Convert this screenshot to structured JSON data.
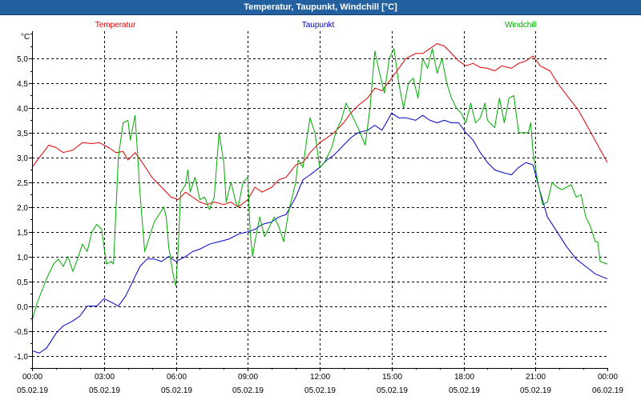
{
  "window": {
    "title": "Temperatur, Taupunkt, Windchill [°C]"
  },
  "chart_data": {
    "type": "line",
    "title": "Temperatur, Taupunkt, Windchill [°C]",
    "ylabel": "°C",
    "ylim": [
      -1.25,
      5.55
    ],
    "xlim": [
      0,
      24
    ],
    "grid": true,
    "legend_position": "top",
    "y_ticks": [
      -1.0,
      -0.5,
      0.0,
      0.5,
      1.0,
      1.5,
      2.0,
      2.5,
      3.0,
      3.5,
      4.0,
      4.5,
      5.0
    ],
    "y_tick_labels": [
      "-1,0",
      "-0,5",
      "0,0",
      "0,5",
      "1,0",
      "1,5",
      "2,0",
      "2,5",
      "3,0",
      "3,5",
      "4,0",
      "4,5",
      "5,0"
    ],
    "x_ticks": [
      {
        "hour": 0,
        "time": "00:00",
        "date": "05.02.19"
      },
      {
        "hour": 3,
        "time": "03:00",
        "date": "05.02.19"
      },
      {
        "hour": 6,
        "time": "06:00",
        "date": "05.02.19"
      },
      {
        "hour": 9,
        "time": "09:00",
        "date": "05.02.19"
      },
      {
        "hour": 12,
        "time": "12:00",
        "date": "05.02.19"
      },
      {
        "hour": 15,
        "time": "15:00",
        "date": "05.02.19"
      },
      {
        "hour": 18,
        "time": "18:00",
        "date": "05.02.19"
      },
      {
        "hour": 21,
        "time": "21:00",
        "date": "05.02.19"
      },
      {
        "hour": 24,
        "time": "00:00",
        "date": "06.02.19"
      }
    ],
    "series": [
      {
        "name": "Temperatur",
        "color": "#e00000",
        "points": [
          [
            0,
            2.8
          ],
          [
            0.3,
            3.0
          ],
          [
            0.7,
            3.25
          ],
          [
            1.0,
            3.2
          ],
          [
            1.3,
            3.1
          ],
          [
            1.7,
            3.15
          ],
          [
            2.1,
            3.3
          ],
          [
            2.5,
            3.28
          ],
          [
            2.8,
            3.3
          ],
          [
            3.2,
            3.2
          ],
          [
            3.5,
            3.1
          ],
          [
            3.8,
            3.12
          ],
          [
            4.0,
            2.95
          ],
          [
            4.3,
            3.1
          ],
          [
            4.6,
            2.9
          ],
          [
            5.0,
            2.6
          ],
          [
            5.4,
            2.4
          ],
          [
            5.8,
            2.2
          ],
          [
            6.1,
            2.15
          ],
          [
            6.4,
            2.3
          ],
          [
            6.7,
            2.2
          ],
          [
            7.0,
            2.1
          ],
          [
            7.3,
            2.05
          ],
          [
            7.6,
            2.1
          ],
          [
            8.0,
            2.05
          ],
          [
            8.3,
            2.1
          ],
          [
            8.6,
            2.0
          ],
          [
            9.0,
            2.15
          ],
          [
            9.3,
            2.4
          ],
          [
            9.6,
            2.3
          ],
          [
            10.0,
            2.4
          ],
          [
            10.3,
            2.55
          ],
          [
            10.6,
            2.6
          ],
          [
            11.0,
            2.85
          ],
          [
            11.3,
            2.9
          ],
          [
            11.6,
            3.1
          ],
          [
            12.0,
            3.3
          ],
          [
            12.3,
            3.4
          ],
          [
            12.6,
            3.5
          ],
          [
            13.0,
            3.7
          ],
          [
            13.3,
            3.9
          ],
          [
            13.6,
            4.05
          ],
          [
            14.0,
            4.2
          ],
          [
            14.3,
            4.4
          ],
          [
            14.6,
            4.35
          ],
          [
            15.0,
            4.6
          ],
          [
            15.3,
            4.8
          ],
          [
            15.6,
            5.0
          ],
          [
            16.0,
            5.1
          ],
          [
            16.3,
            5.1
          ],
          [
            16.6,
            5.2
          ],
          [
            16.9,
            5.3
          ],
          [
            17.2,
            5.25
          ],
          [
            17.5,
            5.1
          ],
          [
            17.8,
            4.95
          ],
          [
            18.1,
            4.85
          ],
          [
            18.4,
            4.9
          ],
          [
            18.7,
            4.82
          ],
          [
            19.0,
            4.8
          ],
          [
            19.3,
            4.75
          ],
          [
            19.6,
            4.85
          ],
          [
            20.0,
            4.8
          ],
          [
            20.3,
            4.9
          ],
          [
            20.6,
            4.95
          ],
          [
            20.9,
            5.05
          ],
          [
            21.2,
            4.85
          ],
          [
            21.6,
            4.75
          ],
          [
            22.0,
            4.45
          ],
          [
            22.4,
            4.2
          ],
          [
            22.8,
            3.95
          ],
          [
            23.2,
            3.6
          ],
          [
            23.6,
            3.25
          ],
          [
            24,
            2.9
          ]
        ]
      },
      {
        "name": "Taupunkt",
        "color": "#0000cc",
        "points": [
          [
            0,
            -0.9
          ],
          [
            0.3,
            -0.95
          ],
          [
            0.6,
            -0.85
          ],
          [
            1.0,
            -0.55
          ],
          [
            1.3,
            -0.4
          ],
          [
            1.7,
            -0.3
          ],
          [
            2.0,
            -0.2
          ],
          [
            2.3,
            0.0
          ],
          [
            2.7,
            0.0
          ],
          [
            3.0,
            0.15
          ],
          [
            3.3,
            0.08
          ],
          [
            3.6,
            0.0
          ],
          [
            3.9,
            0.2
          ],
          [
            4.2,
            0.5
          ],
          [
            4.5,
            0.8
          ],
          [
            4.8,
            0.95
          ],
          [
            5.1,
            0.95
          ],
          [
            5.4,
            0.9
          ],
          [
            5.7,
            1.0
          ],
          [
            6.0,
            0.9
          ],
          [
            6.4,
            1.0
          ],
          [
            6.7,
            1.1
          ],
          [
            7.0,
            1.15
          ],
          [
            7.4,
            1.25
          ],
          [
            7.8,
            1.3
          ],
          [
            8.2,
            1.35
          ],
          [
            8.6,
            1.45
          ],
          [
            9.0,
            1.5
          ],
          [
            9.3,
            1.55
          ],
          [
            9.6,
            1.65
          ],
          [
            10.0,
            1.7
          ],
          [
            10.3,
            1.8
          ],
          [
            10.6,
            1.85
          ],
          [
            11.0,
            2.2
          ],
          [
            11.3,
            2.55
          ],
          [
            11.6,
            2.65
          ],
          [
            12.0,
            2.8
          ],
          [
            12.3,
            2.95
          ],
          [
            12.6,
            3.05
          ],
          [
            13.0,
            3.25
          ],
          [
            13.3,
            3.4
          ],
          [
            13.6,
            3.5
          ],
          [
            14.0,
            3.55
          ],
          [
            14.3,
            3.65
          ],
          [
            14.6,
            3.55
          ],
          [
            15.0,
            3.9
          ],
          [
            15.3,
            3.8
          ],
          [
            15.6,
            3.8
          ],
          [
            16.0,
            3.75
          ],
          [
            16.3,
            3.85
          ],
          [
            16.6,
            3.75
          ],
          [
            16.9,
            3.7
          ],
          [
            17.2,
            3.75
          ],
          [
            17.5,
            3.7
          ],
          [
            17.8,
            3.7
          ],
          [
            18.1,
            3.5
          ],
          [
            18.4,
            3.35
          ],
          [
            18.7,
            3.1
          ],
          [
            19.0,
            2.9
          ],
          [
            19.3,
            2.75
          ],
          [
            19.6,
            2.7
          ],
          [
            20.0,
            2.65
          ],
          [
            20.3,
            2.8
          ],
          [
            20.6,
            2.9
          ],
          [
            20.9,
            2.85
          ],
          [
            21.2,
            2.3
          ],
          [
            21.5,
            1.8
          ],
          [
            21.9,
            1.5
          ],
          [
            22.3,
            1.2
          ],
          [
            22.7,
            0.95
          ],
          [
            23.1,
            0.8
          ],
          [
            23.5,
            0.65
          ],
          [
            24,
            0.55
          ]
        ]
      },
      {
        "name": "Windchill",
        "color": "#00aa00",
        "points": [
          [
            0,
            -0.3
          ],
          [
            0.2,
            0.05
          ],
          [
            0.4,
            0.3
          ],
          [
            0.6,
            0.55
          ],
          [
            0.9,
            0.85
          ],
          [
            1.1,
            0.95
          ],
          [
            1.3,
            0.8
          ],
          [
            1.5,
            1.0
          ],
          [
            1.7,
            0.7
          ],
          [
            1.9,
            0.95
          ],
          [
            2.1,
            1.25
          ],
          [
            2.3,
            1.1
          ],
          [
            2.5,
            1.5
          ],
          [
            2.7,
            1.65
          ],
          [
            2.9,
            1.55
          ],
          [
            3.0,
            1.2
          ],
          [
            3.1,
            0.85
          ],
          [
            3.3,
            0.9
          ],
          [
            3.4,
            0.85
          ],
          [
            3.6,
            3.0
          ],
          [
            3.8,
            3.7
          ],
          [
            4.0,
            3.75
          ],
          [
            4.1,
            3.35
          ],
          [
            4.3,
            3.85
          ],
          [
            4.4,
            3.1
          ],
          [
            4.5,
            2.3
          ],
          [
            4.7,
            1.1
          ],
          [
            4.9,
            1.4
          ],
          [
            5.1,
            1.7
          ],
          [
            5.3,
            1.85
          ],
          [
            5.5,
            2.0
          ],
          [
            5.6,
            1.8
          ],
          [
            5.7,
            1.2
          ],
          [
            5.9,
            0.6
          ],
          [
            6.0,
            0.4
          ],
          [
            6.1,
            1.2
          ],
          [
            6.2,
            2.3
          ],
          [
            6.4,
            2.45
          ],
          [
            6.5,
            2.75
          ],
          [
            6.6,
            2.3
          ],
          [
            6.8,
            2.6
          ],
          [
            7.0,
            2.15
          ],
          [
            7.2,
            2.2
          ],
          [
            7.4,
            1.95
          ],
          [
            7.6,
            2.2
          ],
          [
            7.8,
            3.5
          ],
          [
            8.0,
            2.9
          ],
          [
            8.1,
            2.1
          ],
          [
            8.3,
            2.5
          ],
          [
            8.5,
            2.1
          ],
          [
            8.6,
            2.0
          ],
          [
            8.8,
            2.5
          ],
          [
            9.0,
            2.6
          ],
          [
            9.1,
            1.5
          ],
          [
            9.2,
            1.0
          ],
          [
            9.3,
            1.3
          ],
          [
            9.5,
            1.8
          ],
          [
            9.7,
            1.4
          ],
          [
            9.9,
            1.6
          ],
          [
            10.1,
            1.8
          ],
          [
            10.3,
            1.6
          ],
          [
            10.5,
            1.3
          ],
          [
            10.7,
            1.9
          ],
          [
            11.0,
            2.5
          ],
          [
            11.1,
            2.95
          ],
          [
            11.3,
            2.8
          ],
          [
            11.5,
            3.5
          ],
          [
            11.6,
            3.8
          ],
          [
            11.8,
            3.5
          ],
          [
            12.0,
            2.8
          ],
          [
            12.2,
            2.9
          ],
          [
            12.5,
            3.2
          ],
          [
            12.7,
            3.55
          ],
          [
            12.9,
            3.75
          ],
          [
            13.1,
            4.1
          ],
          [
            13.3,
            3.9
          ],
          [
            13.6,
            3.6
          ],
          [
            13.9,
            3.25
          ],
          [
            14.1,
            4.0
          ],
          [
            14.3,
            5.15
          ],
          [
            14.5,
            4.7
          ],
          [
            14.7,
            4.3
          ],
          [
            14.9,
            5.0
          ],
          [
            15.1,
            5.2
          ],
          [
            15.3,
            4.5
          ],
          [
            15.5,
            4.0
          ],
          [
            15.7,
            4.5
          ],
          [
            15.9,
            4.6
          ],
          [
            16.1,
            4.2
          ],
          [
            16.3,
            5.0
          ],
          [
            16.5,
            4.8
          ],
          [
            16.7,
            5.2
          ],
          [
            16.9,
            4.7
          ],
          [
            17.1,
            5.0
          ],
          [
            17.3,
            4.5
          ],
          [
            17.5,
            4.2
          ],
          [
            17.7,
            4.0
          ],
          [
            17.9,
            3.9
          ],
          [
            18.1,
            3.7
          ],
          [
            18.3,
            4.1
          ],
          [
            18.5,
            3.7
          ],
          [
            18.7,
            3.8
          ],
          [
            18.9,
            4.1
          ],
          [
            19.0,
            3.75
          ],
          [
            19.3,
            3.6
          ],
          [
            19.5,
            4.2
          ],
          [
            19.7,
            3.7
          ],
          [
            19.9,
            4.2
          ],
          [
            20.1,
            4.25
          ],
          [
            20.3,
            3.5
          ],
          [
            20.5,
            3.5
          ],
          [
            20.7,
            3.5
          ],
          [
            20.8,
            3.7
          ],
          [
            20.9,
            3.1
          ],
          [
            21.1,
            2.5
          ],
          [
            21.3,
            2.05
          ],
          [
            21.5,
            2.1
          ],
          [
            21.7,
            2.5
          ],
          [
            21.9,
            2.4
          ],
          [
            22.1,
            2.35
          ],
          [
            22.3,
            2.4
          ],
          [
            22.5,
            2.45
          ],
          [
            22.7,
            2.2
          ],
          [
            22.9,
            2.25
          ],
          [
            23.1,
            1.8
          ],
          [
            23.3,
            1.6
          ],
          [
            23.5,
            1.3
          ],
          [
            23.6,
            1.3
          ],
          [
            23.7,
            0.9
          ],
          [
            24,
            0.85
          ]
        ]
      }
    ]
  }
}
